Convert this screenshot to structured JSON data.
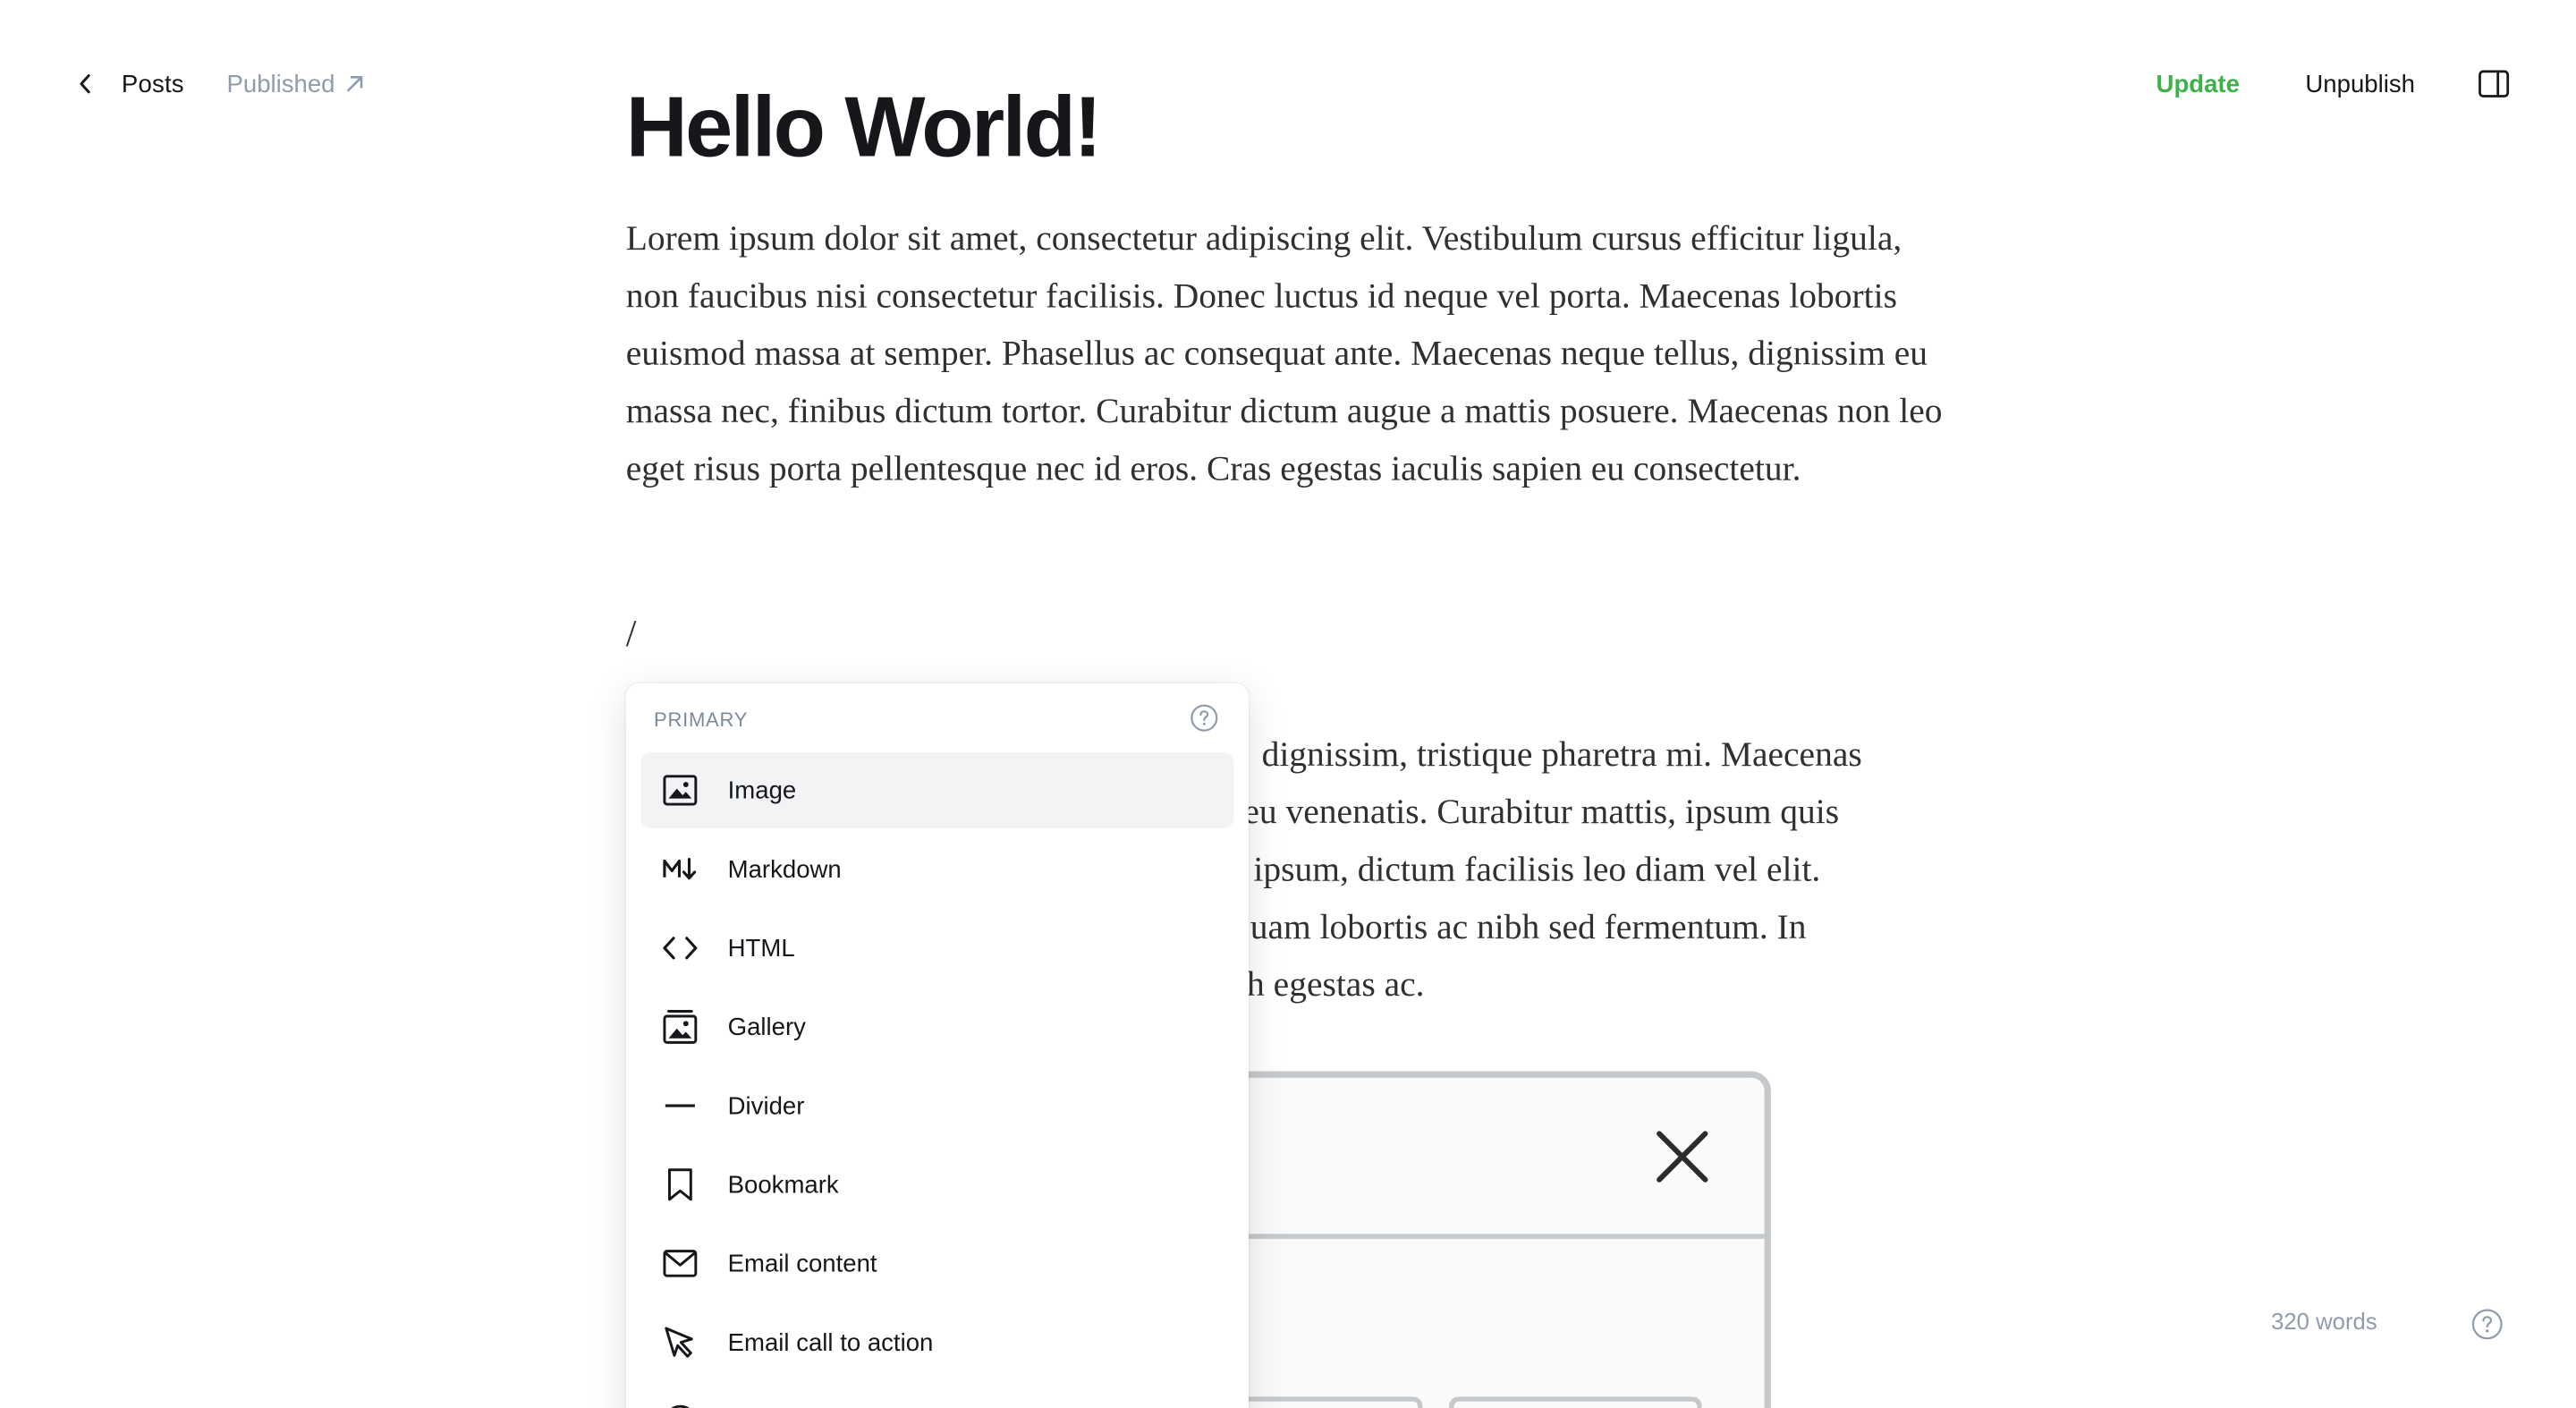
{
  "topbar": {
    "back_label": "Posts",
    "status_label": "Published",
    "update_label": "Update",
    "unpublish_label": "Unpublish"
  },
  "post": {
    "title": "Hello World!",
    "paragraph_1": "Lorem ipsum dolor sit amet, consectetur adipiscing elit. Vestibulum cursus efficitur ligula, non faucibus nisi consectetur facilisis. Donec luctus id neque vel porta. Maecenas lobortis euismod massa at semper. Phasellus ac consequat ante. Maecenas neque tellus, dignissim eu massa nec, finibus dictum tortor. Curabitur dictum augue a mattis posuere. Maecenas non leo eget risus porta pellentesque nec id eros. Cras egestas iaculis sapien eu consectetur.",
    "slash_command": "/",
    "paragraph_2_visible_lines": [
      "dignissim, tristique pharetra mi. Maecenas",
      "eu venenatis. Curabitur mattis, ipsum quis",
      "ipsum, dictum facilisis leo diam vel elit.",
      "uam lobortis ac nibh sed fermentum. In",
      "h egestas ac."
    ]
  },
  "card_menu": {
    "section_label": "PRIMARY",
    "items": [
      {
        "label": "Image",
        "icon": "image-icon",
        "selected": true
      },
      {
        "label": "Markdown",
        "icon": "markdown-icon",
        "selected": false
      },
      {
        "label": "HTML",
        "icon": "code-icon",
        "selected": false
      },
      {
        "label": "Gallery",
        "icon": "gallery-icon",
        "selected": false
      },
      {
        "label": "Divider",
        "icon": "divider-icon",
        "selected": false
      },
      {
        "label": "Bookmark",
        "icon": "bookmark-icon",
        "selected": false
      },
      {
        "label": "Email content",
        "icon": "email-icon",
        "selected": false
      },
      {
        "label": "Email call to action",
        "icon": "cursor-icon",
        "selected": false
      }
    ]
  },
  "footer": {
    "word_count": "320 words"
  },
  "colors": {
    "accent_green": "#3eb24a",
    "muted_text": "#8e9cac",
    "selected_bg": "#f1f3f4"
  }
}
